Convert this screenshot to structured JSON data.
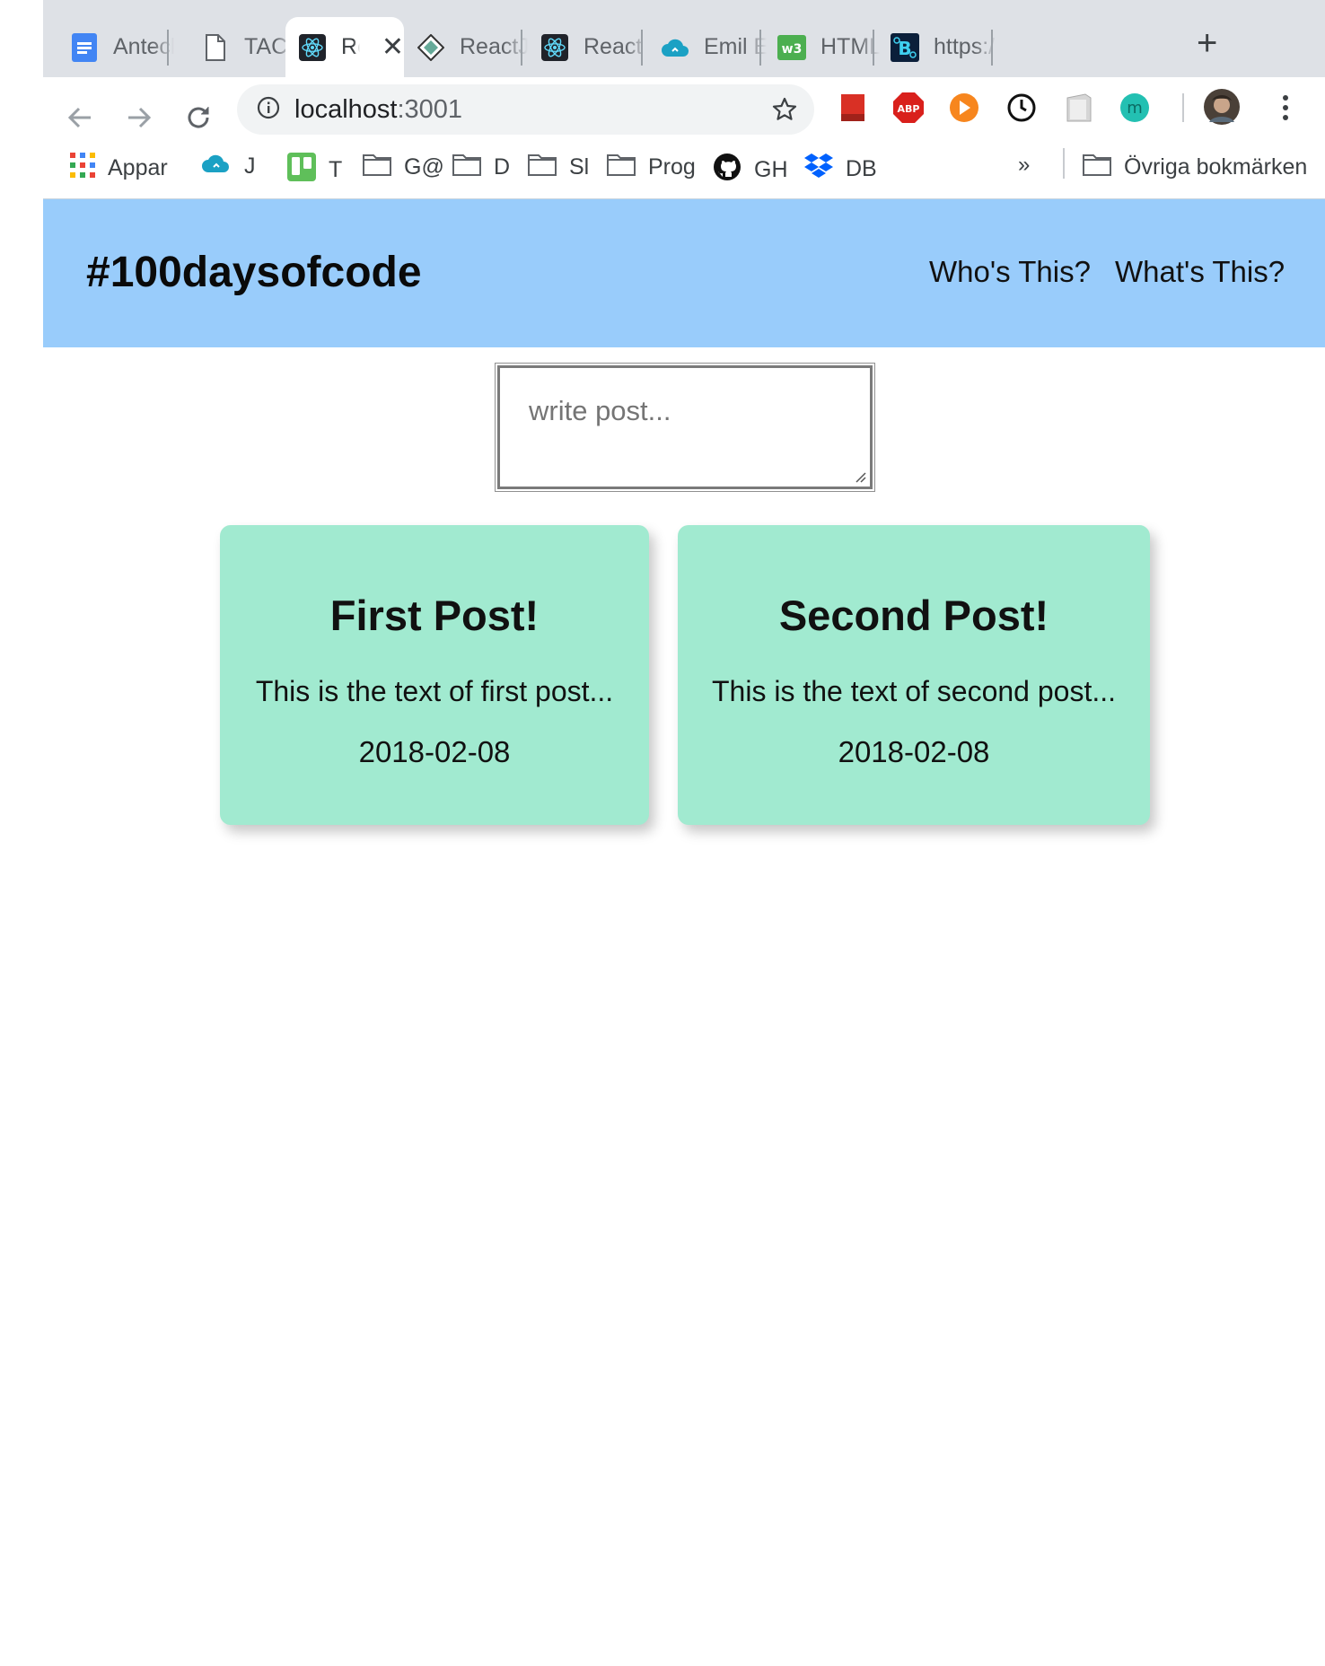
{
  "browser": {
    "tabs": [
      {
        "label": "Anteck",
        "icon": "google-docs-icon"
      },
      {
        "label": "TACHY",
        "icon": "document-icon"
      },
      {
        "label": "React",
        "icon": "react-icon",
        "active": true
      },
      {
        "label": "ReactJ",
        "icon": "reactjs-diamond-icon"
      },
      {
        "label": "React",
        "icon": "react-icon"
      },
      {
        "label": "Emil Er",
        "icon": "cloud-icon"
      },
      {
        "label": "HTML",
        "icon": "w3-icon"
      },
      {
        "label": "https:/",
        "icon": "bootstrap-icon"
      }
    ],
    "url_host": "localhost",
    "url_port": ":3001",
    "bookmarks": [
      {
        "label": "Appar",
        "icon": "apps-grid-icon"
      },
      {
        "label": "J",
        "icon": "cloud-icon"
      },
      {
        "label": "T",
        "icon": "trello-icon"
      },
      {
        "label": "G@",
        "icon": "folder-icon"
      },
      {
        "label": "D",
        "icon": "folder-icon"
      },
      {
        "label": "Sl",
        "icon": "folder-icon"
      },
      {
        "label": "Prog",
        "icon": "folder-icon"
      },
      {
        "label": "GH",
        "icon": "github-icon"
      },
      {
        "label": "DB",
        "icon": "dropbox-icon"
      }
    ],
    "more_bookmarks": "»",
    "other_bookmarks": "Övriga bokmärken"
  },
  "app": {
    "title": "#100daysofcode",
    "nav": [
      "Who's This?",
      "What's This?"
    ],
    "post_placeholder": "write post...",
    "posts": [
      {
        "title": "First Post!",
        "text": "This is the text of first post...",
        "date": "2018-02-08"
      },
      {
        "title": "Second Post!",
        "text": "This is the text of second post...",
        "date": "2018-02-08"
      }
    ]
  },
  "colors": {
    "header_bg": "#99ccfb",
    "card_bg": "#a1ead0",
    "tabstrip_bg": "#dee1e6"
  }
}
